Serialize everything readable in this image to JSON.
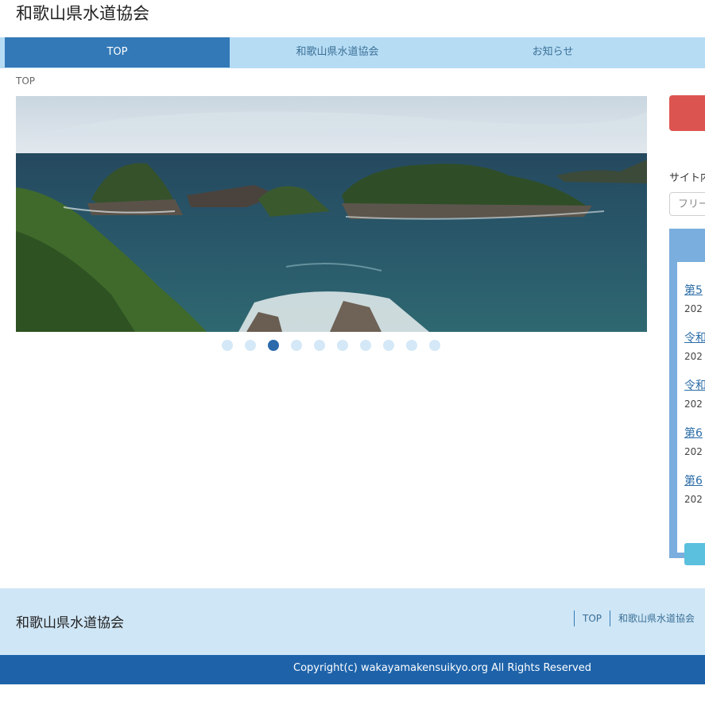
{
  "header": {
    "site_title": "和歌山県水道協会"
  },
  "nav": {
    "items": [
      {
        "label": "TOP",
        "active": true
      },
      {
        "label": "和歌山県水道協会",
        "active": false
      },
      {
        "label": "お知らせ",
        "active": false
      }
    ]
  },
  "breadcrumb": {
    "current": "TOP"
  },
  "slider": {
    "dot_count": 10,
    "active_index": 2
  },
  "sidebar": {
    "search_label": "サイト内",
    "search_placeholder": "フリーワード",
    "news": [
      {
        "title": "第5",
        "date": "202"
      },
      {
        "title": "令和",
        "date": "202"
      },
      {
        "title": "令和",
        "date": "202"
      },
      {
        "title": "第6",
        "date": "202"
      },
      {
        "title": "第6",
        "date": "202"
      }
    ]
  },
  "footer": {
    "title": "和歌山県水道協会",
    "links": [
      "TOP",
      "和歌山県水道協会"
    ],
    "copyright": "Copyright(c) wakayamakensuikyo.org All Rights Reserved"
  },
  "colors": {
    "nav_bg": "#b6dcf4",
    "nav_active": "#3379b7",
    "footer_bg": "#cfe6f6",
    "copyright_bg": "#1e63aa",
    "accent_red": "#dc5450",
    "news_box": "#7aaede",
    "info_button": "#5bc0de"
  }
}
